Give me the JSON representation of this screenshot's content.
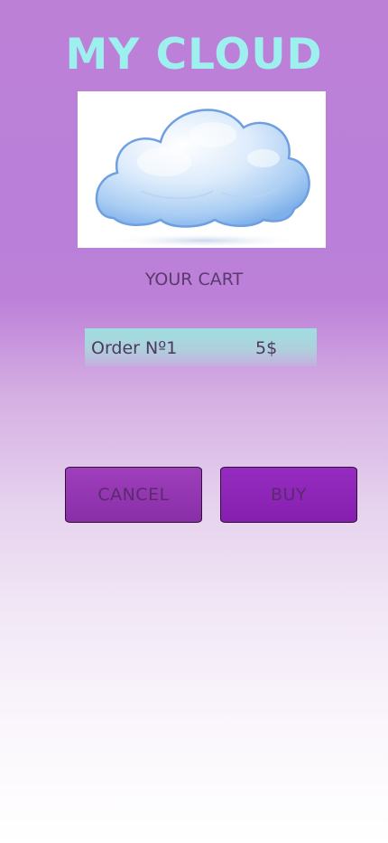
{
  "header": {
    "title": "MY CLOUD"
  },
  "hero": {
    "image": "cloud-illustration"
  },
  "cart": {
    "heading": "YOUR CART",
    "items": [
      {
        "name": "Order Nº1",
        "price": "5$"
      }
    ]
  },
  "actions": {
    "cancel_label": "CANCEL",
    "buy_label": "BUY"
  },
  "colors": {
    "title": "#9ef0ee",
    "background_top": "#bd80d7",
    "background_bottom": "#ffffff",
    "row_background": "#9ddfe0",
    "button": "#8e2fb0"
  }
}
